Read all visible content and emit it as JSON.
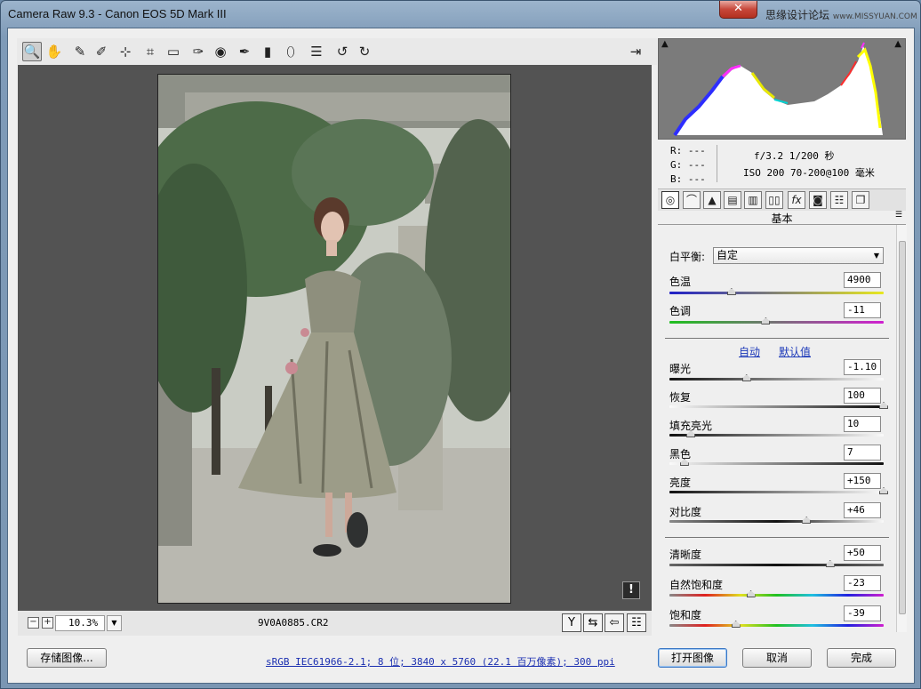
{
  "window": {
    "title": "Camera Raw 9.3 -  Canon EOS 5D Mark III",
    "watermark": "思缘设计论坛",
    "watermark_url": "www.MISSYUAN.COM",
    "close_label": "✕"
  },
  "toolbar": {
    "tools": [
      {
        "name": "zoom-tool",
        "icon": "magnifier",
        "glyph": "🔍"
      },
      {
        "name": "hand-tool",
        "icon": "hand",
        "glyph": "✋"
      },
      {
        "name": "white-balance-tool",
        "icon": "eyedropper",
        "glyph": "✎"
      },
      {
        "name": "color-sampler-tool",
        "icon": "eyedropper-plus",
        "glyph": "✐"
      },
      {
        "name": "targeted-adjustment-tool",
        "icon": "target",
        "glyph": "⊹"
      },
      {
        "name": "crop-tool",
        "icon": "crop",
        "glyph": "⌗"
      },
      {
        "name": "straighten-tool",
        "icon": "level",
        "glyph": "▭"
      },
      {
        "name": "spot-removal-tool",
        "icon": "brush-spot",
        "glyph": "✑"
      },
      {
        "name": "red-eye-tool",
        "icon": "eye",
        "glyph": "◉"
      },
      {
        "name": "adjustment-brush-tool",
        "icon": "brush",
        "glyph": "✒"
      },
      {
        "name": "graduated-filter-tool",
        "icon": "graduated",
        "glyph": "▮"
      },
      {
        "name": "radial-filter-tool",
        "icon": "radial",
        "glyph": "⬯"
      },
      {
        "name": "preferences",
        "icon": "list",
        "glyph": "☰"
      },
      {
        "name": "rotate-left",
        "icon": "rotate-ccw",
        "glyph": "↺"
      },
      {
        "name": "rotate-right",
        "icon": "rotate-cw",
        "glyph": "↻"
      }
    ],
    "fullscreen_glyph": "⇥"
  },
  "preview": {
    "warning_glyph": "!",
    "zoom": "10.3%",
    "zoom_minus": "−",
    "zoom_plus": "+",
    "filename": "9V0A0885.CR2"
  },
  "histogram": {
    "shadow_clip_glyph": "▲",
    "highlight_clip_glyph": "▲"
  },
  "readout": {
    "r": "R:  ---",
    "g": "G:  ---",
    "b": "B:  ---",
    "aperture_shutter": "f/3.2  1/200 秒",
    "iso_lens": "ISO 200  70-200@100 毫米"
  },
  "panel": {
    "tab_glyphs": [
      "◎",
      "⌒",
      "▲",
      "▤",
      "▥",
      "▯▯",
      "fx",
      "◙",
      "☷",
      "❐"
    ],
    "title": "基本",
    "menu_glyph": "☰",
    "white_balance_label": "白平衡:",
    "white_balance_value": "自定",
    "auto_link": "自动",
    "default_link": "默认值",
    "sliders": [
      {
        "key": "temp",
        "label": "色温",
        "value": "4900",
        "level": 0.29
      },
      {
        "key": "tint",
        "label": "色调",
        "value": "-11",
        "level": 0.45
      },
      {
        "key": "exposure",
        "label": "曝光",
        "value": "-1.10",
        "level": 0.36
      },
      {
        "key": "recovery",
        "label": "恢复",
        "value": "100",
        "level": 1.0
      },
      {
        "key": "fill",
        "label": "填充亮光",
        "value": "10",
        "level": 0.1
      },
      {
        "key": "blacks",
        "label": "黑色",
        "value": "7",
        "level": 0.07
      },
      {
        "key": "brightness",
        "label": "亮度",
        "value": "+150",
        "level": 1.0
      },
      {
        "key": "contrast",
        "label": "对比度",
        "value": "+46",
        "level": 0.64
      },
      {
        "key": "clarity",
        "label": "清晰度",
        "value": "+50",
        "level": 0.75
      },
      {
        "key": "vibrance",
        "label": "自然饱和度",
        "value": "-23",
        "level": 0.38
      },
      {
        "key": "saturation",
        "label": "饱和度",
        "value": "-39",
        "level": 0.31
      }
    ]
  },
  "footer": {
    "save_image": "存储图像...",
    "workflow": "sRGB IEC61966-2.1; 8 位; 3840 x 5760 (22.1 百万像素); 300 ppi",
    "open_image": "打开图像",
    "cancel": "取消",
    "done": "完成"
  },
  "colors": {
    "accent_link": "#1a37b8",
    "preview_bg": "#535353"
  }
}
